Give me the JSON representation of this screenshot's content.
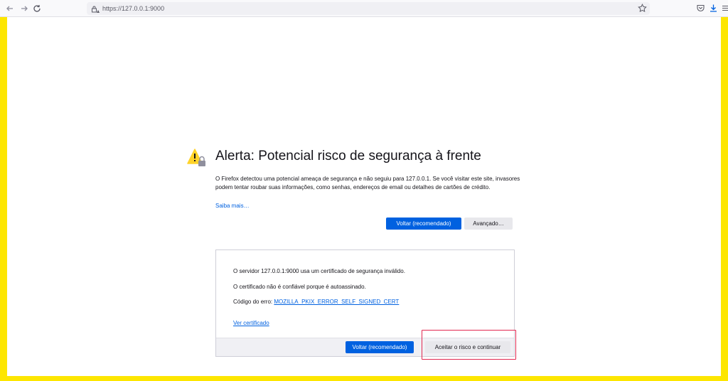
{
  "browser": {
    "url": "https://127.0.0.1:9000",
    "icons": [
      "back-icon",
      "forward-icon",
      "reload-icon",
      "lock-warning-icon",
      "star-icon",
      "pocket-icon",
      "download-icon",
      "menu-icon"
    ]
  },
  "error_page": {
    "title": "Alerta: Potencial risco de segurança à frente",
    "description": "O Firefox detectou uma potencial ameaça de segurança e não seguiu para 127.0.0.1. Se você visitar este site, invasores podem tentar roubar suas informações, como senhas, endereços de email ou detalhes de cartões de crédito.",
    "learn_more": "Saiba mais…",
    "go_back_label": "Voltar (recomendado)",
    "advanced_label": "Avançado…"
  },
  "advanced": {
    "line1": "O servidor 127.0.0.1:9000 usa um certificado de segurança inválido.",
    "line2": "O certificado não é confiável porque é autoassinado.",
    "error_code_label": "Código do erro:",
    "error_code": "MOZILLA_PKIX_ERROR_SELF_SIGNED_CERT",
    "view_certificate": "Ver certificado",
    "go_back_label": "Voltar (recomendado)",
    "accept_label": "Aceitar o risco e continuar"
  },
  "colors": {
    "accent": "#0061e0",
    "background_frame": "#fde600",
    "highlight": "#e22850",
    "warning": "#ffa436"
  }
}
